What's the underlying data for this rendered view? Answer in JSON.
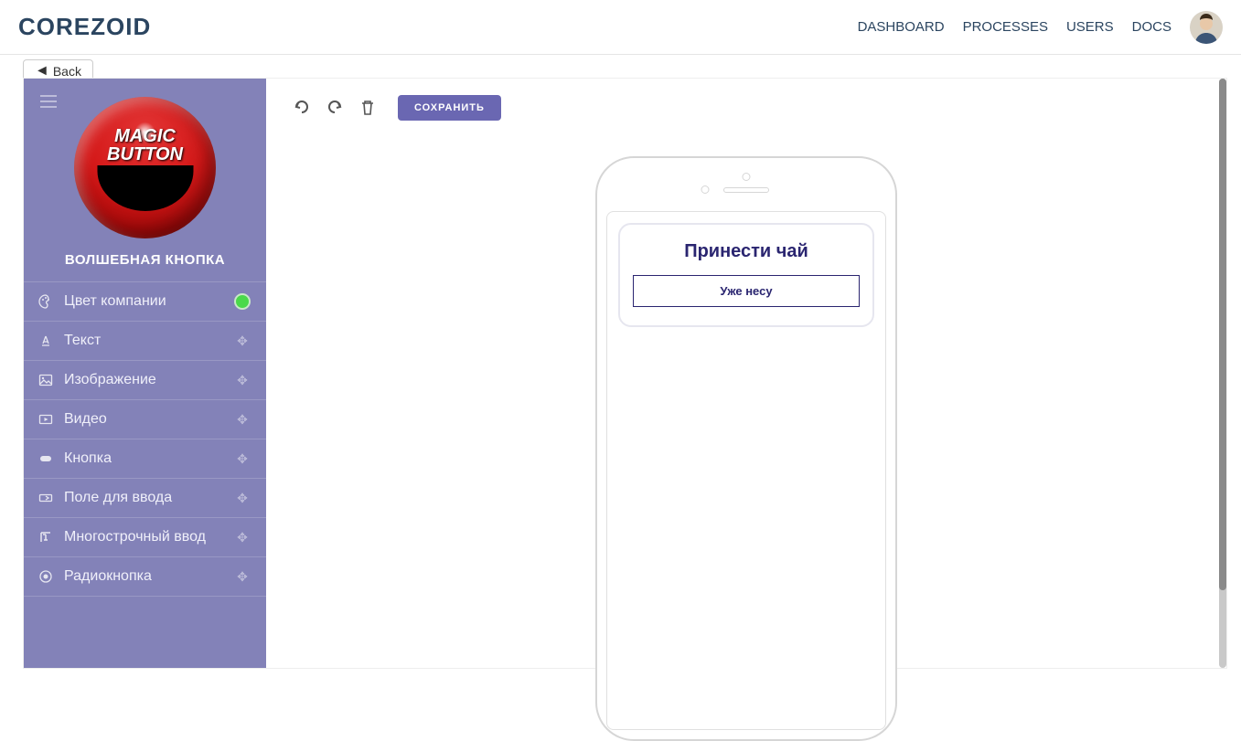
{
  "header": {
    "logo": "COREZOID",
    "nav": {
      "dashboard": "DASHBOARD",
      "processes": "PROCESSES",
      "users": "USERS",
      "docs": "DOCS"
    }
  },
  "back": {
    "label": "Back"
  },
  "sidebar": {
    "app_logo_text_1": "MAGIC",
    "app_logo_text_2": "BUTTON",
    "app_name": "ВОЛШЕБНАЯ КНОПКА",
    "company_color_hex": "#4ad94a",
    "items": [
      {
        "label": "Цвет компании",
        "right": "color"
      },
      {
        "label": "Текст",
        "right": "move"
      },
      {
        "label": "Изображение",
        "right": "move"
      },
      {
        "label": "Видео",
        "right": "move"
      },
      {
        "label": "Кнопка",
        "right": "move"
      },
      {
        "label": "Поле для ввода",
        "right": "move"
      },
      {
        "label": "Многострочный ввод",
        "right": "move"
      },
      {
        "label": "Радиокнопка",
        "right": "move"
      }
    ]
  },
  "toolbar": {
    "save_label": "СОХРАНИТЬ"
  },
  "preview": {
    "card_title": "Принести чай",
    "card_button": "Уже несу"
  }
}
